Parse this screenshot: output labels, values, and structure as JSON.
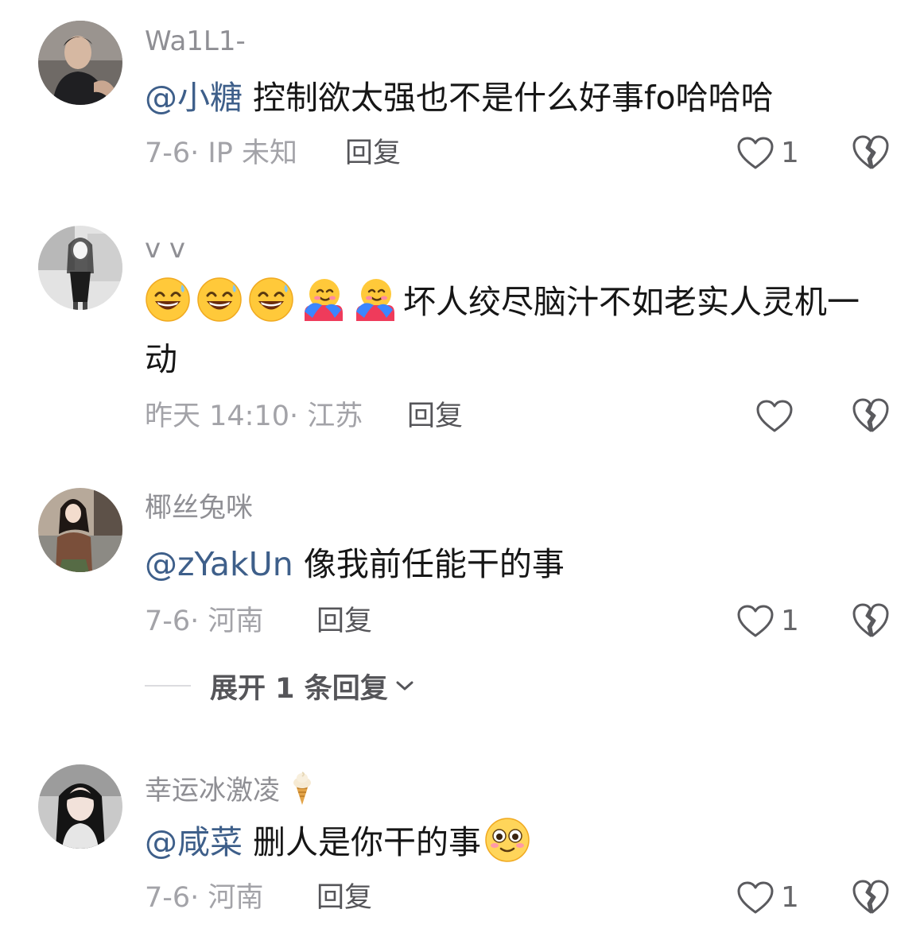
{
  "comments": [
    {
      "username": "Wa1L1-",
      "mention": "@小糖",
      "text": "控制欲太强也不是什么好事fo哈哈哈",
      "meta": "7-6· IP 未知",
      "reply_label": "回复",
      "likes": "1"
    },
    {
      "username": "v v",
      "emojis": [
        "grinning-sweat-emoji",
        "grinning-sweat-emoji",
        "grinning-sweat-emoji",
        "hug-emoji",
        "hug-emoji"
      ],
      "text": "坏人绞尽脑汁不如老实人灵机一动",
      "meta": "昨天 14:10· 江苏",
      "reply_label": "回复",
      "likes": ""
    },
    {
      "username": "椰丝兔咪",
      "mention": "@zYakUn",
      "text": "像我前任能干的事",
      "meta": "7-6· 河南",
      "reply_label": "回复",
      "likes": "1",
      "expand_label": "展开 1 条回复"
    },
    {
      "username": "幸运冰激凌",
      "username_icon": "ice-cream-icon",
      "mention": "@咸菜",
      "text": "删人是你干的事",
      "trailing_emoji": "flushed-emoji",
      "meta": "7-6· 河南",
      "reply_label": "回复",
      "likes": "1"
    }
  ],
  "colors": {
    "mention": "#3e5f8a",
    "username": "#8f8f94",
    "meta": "#a3a3a8",
    "reply": "#555559",
    "icon_stroke": "#5a5a5e"
  }
}
